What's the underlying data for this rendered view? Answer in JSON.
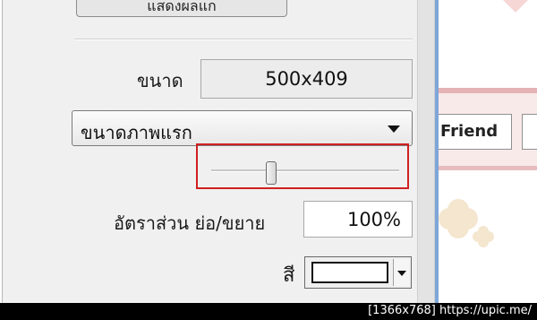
{
  "panel": {
    "top_button_label": "แสดงผลแก",
    "size_label": "ขนาด",
    "size_value": "500x409",
    "preset": {
      "selected": "ขนาดภาพแรก"
    },
    "zoom_slider": {
      "level": 0.32
    },
    "ratio_label": "อัตราส่วน ย่อ/ขยาย",
    "ratio_value": "100%",
    "color_label": "สี",
    "color_value": "#ffffff"
  },
  "page": {
    "friend_button_label": "Friend"
  },
  "watermark": "[1366x768] https://upic.me/",
  "colors": {
    "highlight_box": "#d02020",
    "panel_bg": "#f0f0f0",
    "pink_band": "#f9eaea"
  }
}
